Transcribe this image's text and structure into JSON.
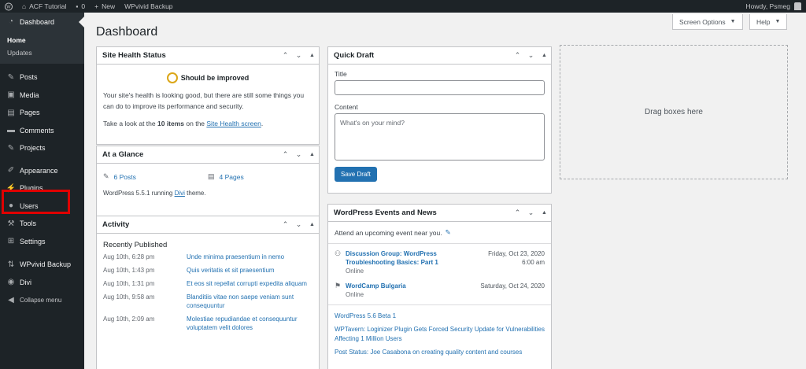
{
  "adminbar": {
    "site_name": "ACF Tutorial",
    "comments_count": "0",
    "new_label": "New",
    "plugin_item": "WPvivid Backup",
    "greeting": "Howdy, Psmeg"
  },
  "sidebar": {
    "dashboard": "Dashboard",
    "submenu": [
      "Home",
      "Updates"
    ],
    "items": [
      "Posts",
      "Media",
      "Pages",
      "Comments",
      "Projects",
      "Appearance",
      "Plugins",
      "Users",
      "Tools",
      "Settings",
      "WPvivid Backup",
      "Divi",
      "Collapse menu"
    ]
  },
  "header": {
    "title": "Dashboard",
    "screen_options": "Screen Options",
    "help": "Help"
  },
  "site_health": {
    "title": "Site Health Status",
    "status": "Should be improved",
    "text": "Your site's health is looking good, but there are still some things you can do to improve its performance and security.",
    "items_prefix": "Take a look at the ",
    "items_count": "10 items",
    "items_mid": " on the ",
    "items_link": "Site Health screen",
    "items_suffix": "."
  },
  "glance": {
    "title": "At a Glance",
    "posts": "6 Posts",
    "pages": "4 Pages",
    "version_prefix": "WordPress 5.5.1 running ",
    "theme": "Divi",
    "version_suffix": " theme."
  },
  "activity": {
    "title": "Activity",
    "heading": "Recently Published",
    "rows": [
      {
        "date": "Aug 10th, 6:28 pm",
        "title": "Unde minima praesentium in nemo"
      },
      {
        "date": "Aug 10th, 1:43 pm",
        "title": "Quis veritatis et sit praesentium"
      },
      {
        "date": "Aug 10th, 1:31 pm",
        "title": "Et eos sit repellat corrupti expedita aliquam"
      },
      {
        "date": "Aug 10th, 9:58 am",
        "title": "Blanditiis vitae non saepe veniam sunt consequuntur"
      },
      {
        "date": "Aug 10th, 2:09 am",
        "title": "Molestiae repudiandae et consequuntur voluptatem velit dolores"
      }
    ]
  },
  "quick_draft": {
    "title": "Quick Draft",
    "title_label": "Title",
    "content_label": "Content",
    "content_placeholder": "What's on your mind?",
    "save_label": "Save Draft"
  },
  "events": {
    "title": "WordPress Events and News",
    "attend": "Attend an upcoming event near you.",
    "list": [
      {
        "title": "Discussion Group: WordPress Troubleshooting Basics: Part 1",
        "type": "Online",
        "date": "Friday, Oct 23, 2020",
        "time": "6:00 am"
      },
      {
        "title": "WordCamp Bulgaria",
        "type": "Online",
        "date": "Saturday, Oct 24, 2020",
        "time": ""
      }
    ],
    "news": [
      "WordPress 5.6 Beta 1",
      "WPTavern: Loginizer Plugin Gets Forced Security Update for Vulnerabilities Affecting 1 Million Users",
      "Post Status: Joe Casabona on creating quality content and courses"
    ]
  },
  "dropzone": "Drag boxes here"
}
